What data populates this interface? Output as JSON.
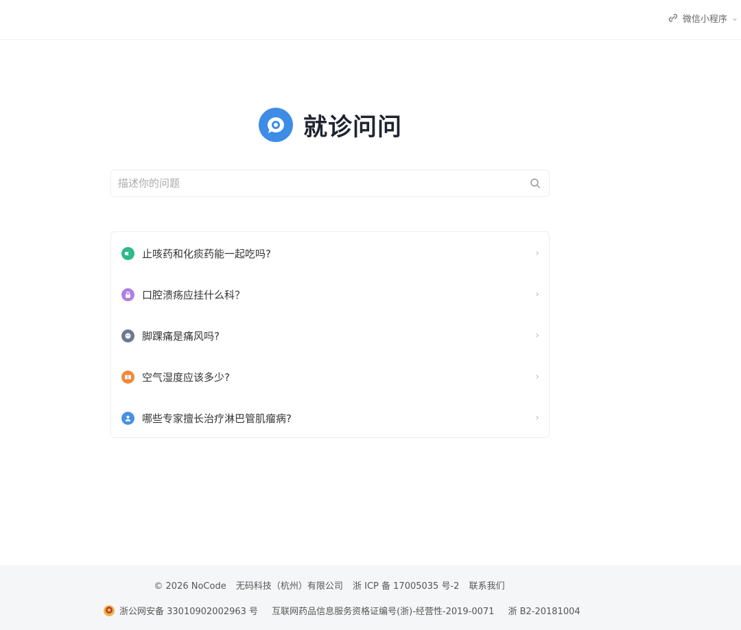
{
  "header": {
    "mini_program_label": "微信小程序",
    "mini_program_icon": "link-icon",
    "chevron_icon": "chevron-down-icon"
  },
  "brand": {
    "title": "就诊问问",
    "logo_icon": "chat-bubble-logo",
    "logo_color": "#3d8de6"
  },
  "search": {
    "placeholder": "描述你的问题",
    "value": "",
    "icon": "search-icon"
  },
  "questions": [
    {
      "text": "止咳药和化痰药能一起吃吗?",
      "icon": "pill-icon",
      "color": "#2db98a"
    },
    {
      "text": "口腔溃疡应挂什么科？",
      "icon": "lock-icon",
      "color": "#b27ee0"
    },
    {
      "text": "脚踝痛是痛风吗?",
      "icon": "face-icon",
      "color": "#6b7a90"
    },
    {
      "text": "空气湿度应该多少?",
      "icon": "book-icon",
      "color": "#f0883a"
    },
    {
      "text": "哪些专家擅长治疗淋巴管肌瘤病?",
      "icon": "user-icon",
      "color": "#4a90e2"
    }
  ],
  "footer": {
    "copyright": "© 2026 NoCode",
    "company": "无码科技（杭州）有限公司",
    "icp": "浙 ICP 备 17005035 号-2",
    "contact": "联系我们",
    "police_record": "浙公网安备 33010902002963 号",
    "drug_license": "互联网药品信息服务资格证编号(浙)-经营性-2019-0071",
    "b2_license": "浙 B2-20181004",
    "police_icon": "police-badge-icon"
  }
}
